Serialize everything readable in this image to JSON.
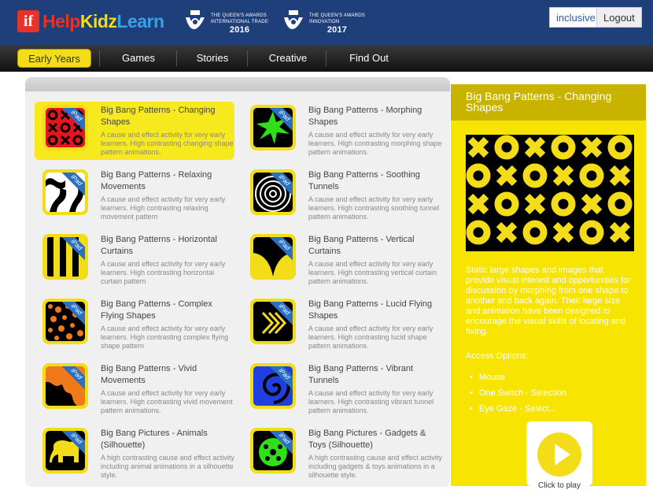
{
  "header": {
    "logo_mark": "if",
    "logo_text_a": "Help",
    "logo_text_b": "Kidz",
    "logo_text_c": "Learn",
    "awards": [
      {
        "line1": "THE QUEEN'S AWARDS",
        "line2": "INTERNATIONAL TRADE",
        "year": "2016"
      },
      {
        "line1": "THE QUEEN'S AWARDS",
        "line2": "INNOVATION",
        "year": "2017"
      }
    ],
    "inclusive_label": "inclusive",
    "logout_label": "Logout"
  },
  "nav": {
    "items": [
      {
        "label": "Early Years",
        "active": true
      },
      {
        "label": "Games",
        "active": false
      },
      {
        "label": "Stories",
        "active": false
      },
      {
        "label": "Creative",
        "active": false
      },
      {
        "label": "Find Out",
        "active": false
      }
    ]
  },
  "activities": [
    {
      "title": "Big Bang Patterns - Changing Shapes",
      "desc": "A cause and effect activity for very early learners. High contrasting changing shape pattern animations.",
      "selected": true,
      "thumb": "xo-pattern",
      "ipad": "iPad"
    },
    {
      "title": "Big Bang Patterns - Morphing Shapes",
      "desc": "A cause and effect activity for very early learners. High contrasting morphing shape pattern animations.",
      "selected": false,
      "thumb": "green-star",
      "ipad": "iPad"
    },
    {
      "title": "Big Bang Patterns - Relaxing Movements",
      "desc": "A cause and effect activity for very early learners. High contrasting relaxing movement pattern",
      "selected": false,
      "thumb": "zebra",
      "ipad": "iPad"
    },
    {
      "title": "Big Bang Patterns - Soothing Tunnels",
      "desc": "A cause and effect activity for very early learners. High contrasting soothing tunnel pattern animations.",
      "selected": false,
      "thumb": "tunnel",
      "ipad": "iPad"
    },
    {
      "title": "Big Bang Patterns - Horizontal Curtains",
      "desc": "A cause and effect activity for very early learners. High contrasting horizontal curtain pattern",
      "selected": false,
      "thumb": "stripes",
      "ipad": "iPad"
    },
    {
      "title": "Big Bang Patterns - Vertical Curtains",
      "desc": "A cause and effect activity for very early learners. High contrasting vertical curtain pattern animations.",
      "selected": false,
      "thumb": "curtain",
      "ipad": "iPad"
    },
    {
      "title": "Big Bang Patterns - Complex Flying Shapes",
      "desc": "A cause and effect activity for very early learners. High contrasting complex flying shape pattern",
      "selected": false,
      "thumb": "dots",
      "ipad": "iPad"
    },
    {
      "title": "Big Bang Patterns - Lucid Flying Shapes",
      "desc": "A cause and effect activity for very early learners. High contrasting lucid shape pattern animations.",
      "selected": false,
      "thumb": "chevrons",
      "ipad": "iPad"
    },
    {
      "title": "Big Bang Patterns - Vivid Movements",
      "desc": "A cause and effect activity for very early learners. High contrasting vivid movement pattern animations.",
      "selected": false,
      "thumb": "vivid",
      "ipad": "iPad"
    },
    {
      "title": "Big Bang Patterns - Vibrant Tunnels",
      "desc": "A cause and effect activity for very early learners. High contrasting vibrant tunnel pattern animations.",
      "selected": false,
      "thumb": "swirl",
      "ipad": "iPad"
    },
    {
      "title": "Big Bang Pictures - Animals (Silhouette)",
      "desc": "A high contrasting cause and effect activity including animal animations in a silhouette style.",
      "selected": false,
      "thumb": "elephant",
      "ipad": "iPad"
    },
    {
      "title": "Big Bang Pictures - Gadgets & Toys (Silhouette)",
      "desc": "A high contrasting cause and effect activity including gadgets & toys animations in a silhouette style.",
      "selected": false,
      "thumb": "ball",
      "ipad": "iPad"
    }
  ],
  "detail": {
    "title": "Big Bang Patterns - Changing Shapes",
    "description": "Static large shapes and images that provide visual interest and opportunities for discussion by morphing from one shape to another and back again. Their large size and animation have been designed to encourage the visual skills of locating and fixing.",
    "access_title": "Access Options:",
    "access_options": [
      "Mouse",
      "One Switch - Selection",
      "Eye Gaze - Select..."
    ],
    "play_label": "Click to play"
  },
  "colors": {
    "header_bg": "#1f3f7a",
    "accent_yellow": "#f3dc18",
    "detail_bg": "#f7e400",
    "logo_red": "#e6332a"
  }
}
